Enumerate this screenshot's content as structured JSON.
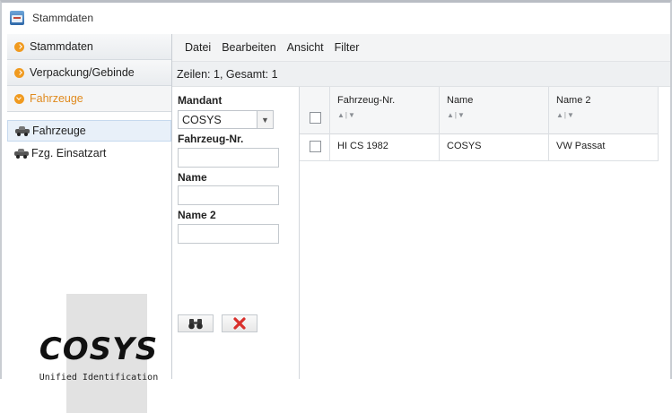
{
  "window": {
    "title": "Stammdaten"
  },
  "sidebar": {
    "sections": [
      {
        "label": "Stammdaten",
        "active": false
      },
      {
        "label": "Verpackung/Gebinde",
        "active": false
      },
      {
        "label": "Fahrzeuge",
        "active": true
      }
    ],
    "tree": [
      {
        "label": "Fahrzeuge",
        "selected": true,
        "icon": "car-icon"
      },
      {
        "label": "Fzg. Einsatzart",
        "selected": false,
        "icon": "car-icon"
      }
    ],
    "logo": {
      "text": "COSYS",
      "subtitle": "Unified Identification"
    }
  },
  "menu": {
    "items": [
      "Datei",
      "Bearbeiten",
      "Ansicht",
      "Filter"
    ]
  },
  "status": {
    "rows_info": "Zeilen: 1, Gesamt: 1"
  },
  "filter": {
    "mandant_label": "Mandant",
    "mandant_value": "COSYS",
    "fahrzeug_nr_label": "Fahrzeug-Nr.",
    "fahrzeug_nr_value": "",
    "name_label": "Name",
    "name_value": "",
    "name2_label": "Name 2",
    "name2_value": "",
    "search_icon": "binoculars-icon",
    "clear_icon": "red-x-icon"
  },
  "table": {
    "columns": [
      "Fahrzeug-Nr.",
      "Name",
      "Name 2"
    ],
    "sort_indicator": "▲|▼",
    "rows": [
      {
        "fahrzeug_nr": "HI CS 1982",
        "name": "COSYS",
        "name2": "VW Passat",
        "checked": false
      }
    ]
  },
  "colors": {
    "accent_orange": "#f09a1f",
    "active_section_text": "#e08a1e",
    "clear_red": "#d9302c"
  }
}
